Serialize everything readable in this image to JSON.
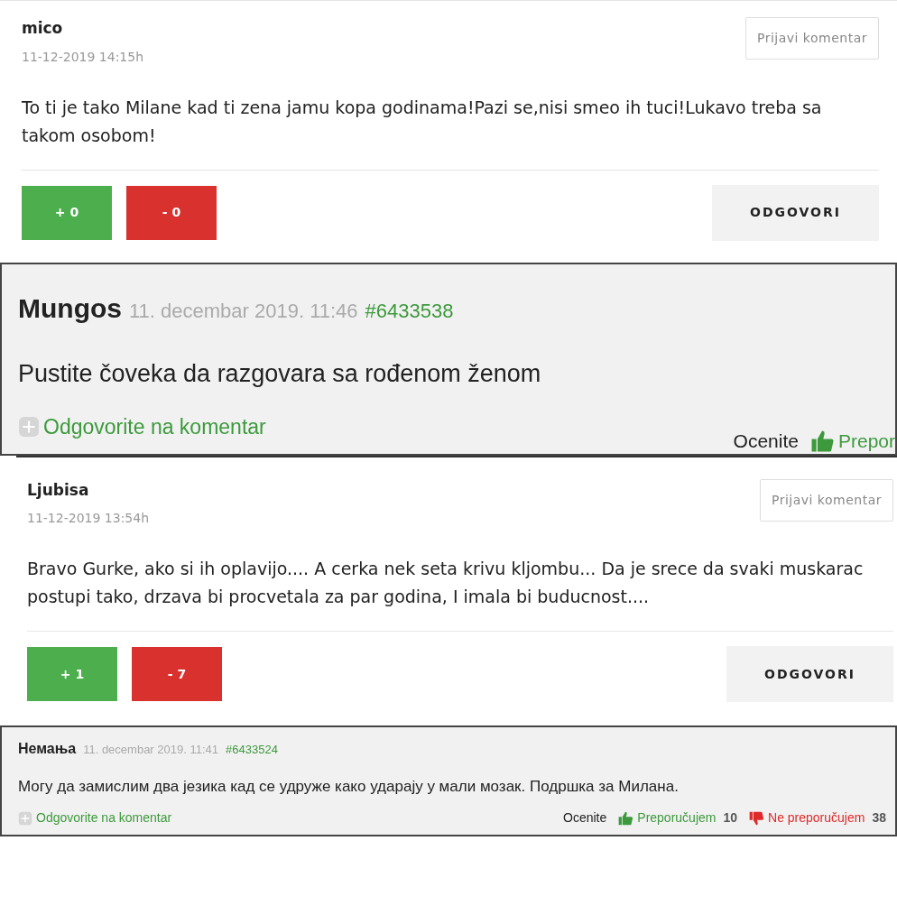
{
  "comments": [
    {
      "kind": "card",
      "author": "mico",
      "date": "11-12-2019 14:15h",
      "report_button": "Prijavi komentar",
      "body": "To ti je tako Milane kad ti zena jamu kopa godinama!Pazi se,nisi smeo ih tuci!Lukavo treba sa takom osobom!",
      "up": "+ 0",
      "down": "- 0",
      "reply_button": "ODGOVORI"
    },
    {
      "kind": "classic",
      "author": "Mungos",
      "date": "11. decembar 2019. 11:46",
      "id": "#6433538",
      "body": "Pustite čoveka da razgovara sa rođenom ženom",
      "reply_link": "Odgovorite na komentar",
      "rate_label": "Ocenite",
      "recommend": "Prepor"
    },
    {
      "kind": "card",
      "author": "Ljubisa",
      "date": "11-12-2019 13:54h",
      "report_button": "Prijavi komentar",
      "body": "Bravo Gurke, ako si ih oplavijo.... A cerka nek seta krivu kljombu... Da je srece da svaki muskarac postupi tako, drzava bi procvetala za par godina, I imala bi buducnost....",
      "up": "+ 1",
      "down": "- 7",
      "reply_button": "ODGOVORI"
    },
    {
      "kind": "compact",
      "author": "Немања",
      "date": "11. decembar 2019. 11:41",
      "id": "#6433524",
      "body": "Могу да замислим два језика кад се удруже како ударају у мали мозак. Подршка за Милана.",
      "reply_link": "Odgovorite na komentar",
      "rate_label": "Ocenite",
      "recommend": "Preporučujem",
      "recommend_count": "10",
      "not_recommend": "Ne preporučujem",
      "not_recommend_count": "38"
    }
  ]
}
